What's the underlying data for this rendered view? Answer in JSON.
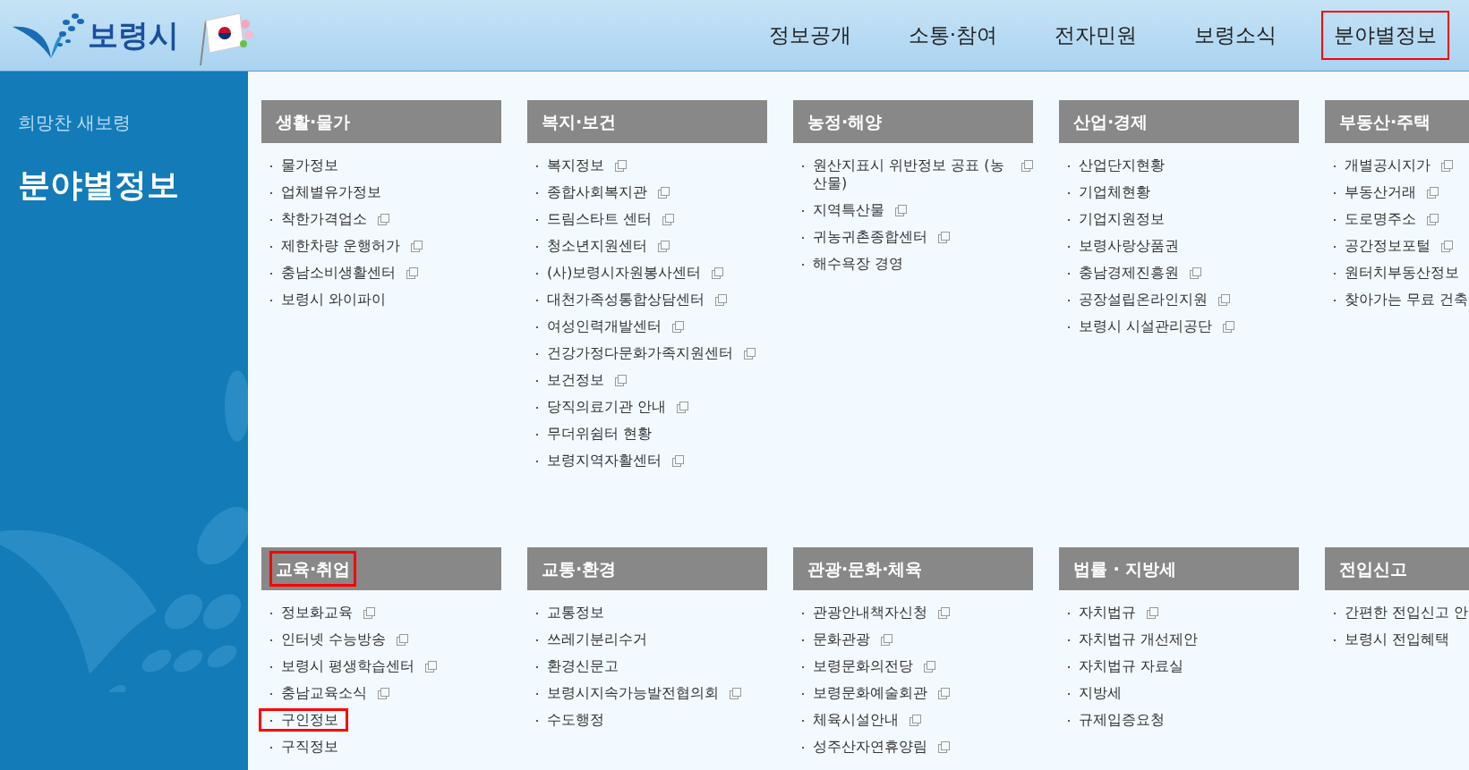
{
  "header": {
    "logo_text": "보령시",
    "nav": [
      {
        "label": "정보공개",
        "highlighted": false
      },
      {
        "label": "소통·참여",
        "highlighted": false
      },
      {
        "label": "전자민원",
        "highlighted": false
      },
      {
        "label": "보령소식",
        "highlighted": false
      },
      {
        "label": "분야별정보",
        "highlighted": true
      }
    ]
  },
  "sidebar": {
    "slogan": "희망찬 새보령",
    "title": "분야별정보"
  },
  "sections": [
    {
      "title": "생활·물가",
      "highlighted": false,
      "items": [
        {
          "label": "물가정보",
          "external": false,
          "highlighted": false
        },
        {
          "label": "업체별유가정보",
          "external": false,
          "highlighted": false
        },
        {
          "label": "착한가격업소",
          "external": true,
          "highlighted": false
        },
        {
          "label": "제한차량 운행허가",
          "external": true,
          "highlighted": false
        },
        {
          "label": "충남소비생활센터",
          "external": true,
          "highlighted": false
        },
        {
          "label": "보령시 와이파이",
          "external": false,
          "highlighted": false
        }
      ]
    },
    {
      "title": "복지·보건",
      "highlighted": false,
      "items": [
        {
          "label": "복지정보",
          "external": true,
          "highlighted": false
        },
        {
          "label": "종합사회복지관",
          "external": true,
          "highlighted": false
        },
        {
          "label": "드림스타트 센터",
          "external": true,
          "highlighted": false
        },
        {
          "label": "청소년지원센터",
          "external": true,
          "highlighted": false
        },
        {
          "label": "(사)보령시자원봉사센터",
          "external": true,
          "highlighted": false
        },
        {
          "label": "대천가족성통합상담센터",
          "external": true,
          "highlighted": false
        },
        {
          "label": "여성인력개발센터",
          "external": true,
          "highlighted": false
        },
        {
          "label": "건강가정다문화가족지원센터",
          "external": true,
          "highlighted": false
        },
        {
          "label": "보건정보",
          "external": true,
          "highlighted": false
        },
        {
          "label": "당직의료기관 안내",
          "external": true,
          "highlighted": false
        },
        {
          "label": "무더위쉼터 현황",
          "external": false,
          "highlighted": false
        },
        {
          "label": "보령지역자활센터",
          "external": true,
          "highlighted": false
        }
      ]
    },
    {
      "title": "농정·해양",
      "highlighted": false,
      "items": [
        {
          "label": "원산지표시 위반정보 공표 (농산물)",
          "external": true,
          "highlighted": false
        },
        {
          "label": "지역특산물",
          "external": true,
          "highlighted": false
        },
        {
          "label": "귀농귀촌종합센터",
          "external": true,
          "highlighted": false
        },
        {
          "label": "해수욕장 경영",
          "external": false,
          "highlighted": false
        }
      ]
    },
    {
      "title": "산업·경제",
      "highlighted": false,
      "items": [
        {
          "label": "산업단지현황",
          "external": false,
          "highlighted": false
        },
        {
          "label": "기업체현황",
          "external": false,
          "highlighted": false
        },
        {
          "label": "기업지원정보",
          "external": false,
          "highlighted": false
        },
        {
          "label": "보령사랑상품권",
          "external": false,
          "highlighted": false
        },
        {
          "label": "충남경제진흥원",
          "external": true,
          "highlighted": false
        },
        {
          "label": "공장설립온라인지원",
          "external": true,
          "highlighted": false
        },
        {
          "label": "보령시 시설관리공단",
          "external": true,
          "highlighted": false
        }
      ]
    },
    {
      "title": "부동산·주택",
      "highlighted": false,
      "items": [
        {
          "label": "개별공시지가",
          "external": true,
          "highlighted": false
        },
        {
          "label": "부동산거래",
          "external": true,
          "highlighted": false
        },
        {
          "label": "도로명주소",
          "external": true,
          "highlighted": false
        },
        {
          "label": "공간정보포털",
          "external": true,
          "highlighted": false
        },
        {
          "label": "원터치부동산정보",
          "highlighted": false
        },
        {
          "label": "찾아가는 무료 건축",
          "highlighted": false
        }
      ]
    },
    {
      "title": "교육·취업",
      "highlighted": true,
      "items": [
        {
          "label": "정보화교육",
          "external": true,
          "highlighted": false
        },
        {
          "label": "인터넷 수능방송",
          "external": true,
          "highlighted": false
        },
        {
          "label": "보령시 평생학습센터",
          "external": true,
          "highlighted": false
        },
        {
          "label": "충남교육소식",
          "external": true,
          "highlighted": false
        },
        {
          "label": "구인정보",
          "external": false,
          "highlighted": true
        },
        {
          "label": "구직정보",
          "external": false,
          "highlighted": false
        }
      ]
    },
    {
      "title": "교통·환경",
      "highlighted": false,
      "items": [
        {
          "label": "교통정보",
          "external": false,
          "highlighted": false
        },
        {
          "label": "쓰레기분리수거",
          "external": false,
          "highlighted": false
        },
        {
          "label": "환경신문고",
          "external": false,
          "highlighted": false
        },
        {
          "label": "보령시지속가능발전협의회",
          "external": true,
          "highlighted": false
        },
        {
          "label": "수도행정",
          "external": false,
          "highlighted": false
        }
      ]
    },
    {
      "title": "관광·문화·체육",
      "highlighted": false,
      "items": [
        {
          "label": "관광안내책자신청",
          "external": true,
          "highlighted": false
        },
        {
          "label": "문화관광",
          "external": true,
          "highlighted": false
        },
        {
          "label": "보령문화의전당",
          "external": true,
          "highlighted": false
        },
        {
          "label": "보령문화예술회관",
          "external": true,
          "highlighted": false
        },
        {
          "label": "체육시설안내",
          "external": true,
          "highlighted": false
        },
        {
          "label": "성주산자연휴양림",
          "external": true,
          "highlighted": false
        }
      ]
    },
    {
      "title": "법률 · 지방세",
      "highlighted": false,
      "items": [
        {
          "label": "자치법규",
          "external": true,
          "highlighted": false
        },
        {
          "label": "자치법규 개선제안",
          "external": false,
          "highlighted": false
        },
        {
          "label": "자치법규 자료실",
          "external": false,
          "highlighted": false
        },
        {
          "label": "지방세",
          "external": false,
          "highlighted": false
        },
        {
          "label": "규제입증요청",
          "external": false,
          "highlighted": false
        }
      ]
    },
    {
      "title": "전입신고",
      "highlighted": false,
      "items": [
        {
          "label": "간편한 전입신고 안",
          "highlighted": false
        },
        {
          "label": "보령시 전입혜택",
          "external": false,
          "highlighted": false
        }
      ]
    }
  ]
}
